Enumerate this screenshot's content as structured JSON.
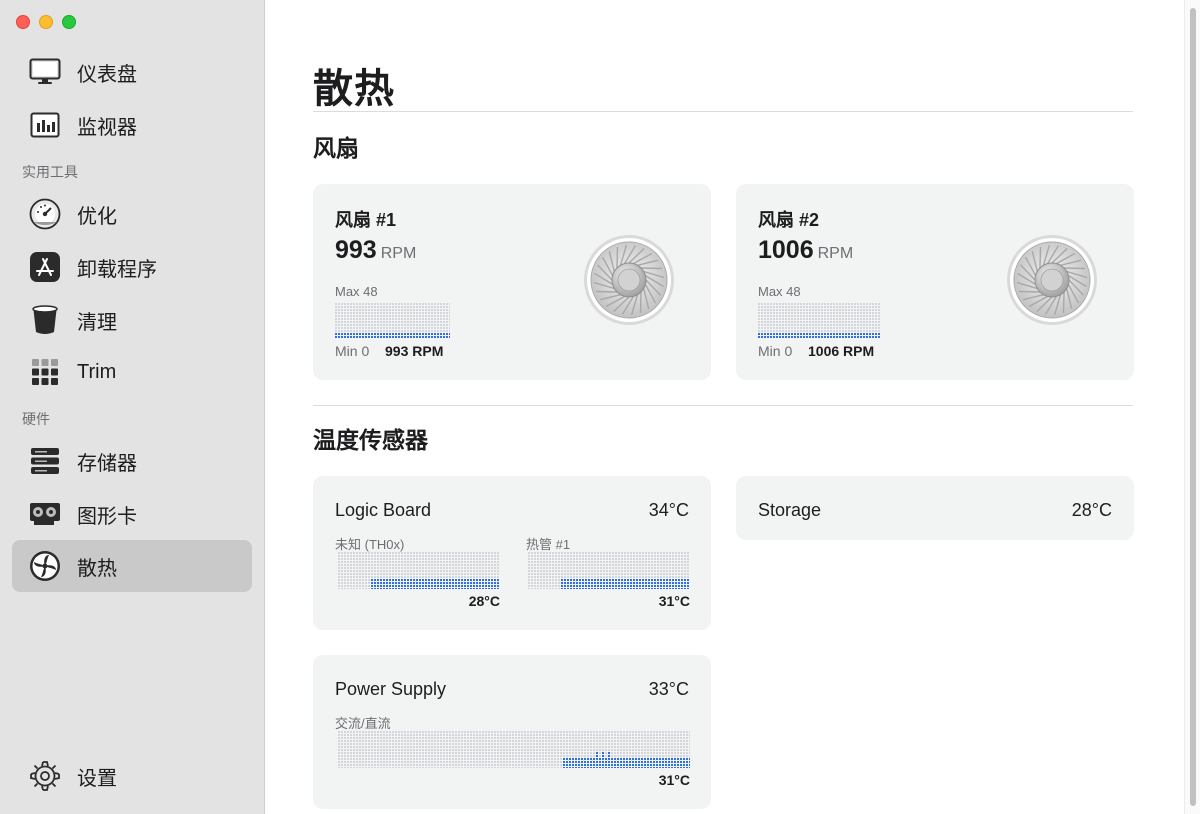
{
  "window": {
    "controls": [
      "close",
      "minimize",
      "zoom"
    ]
  },
  "sidebar": {
    "top_items": [
      {
        "label": "仪表盘",
        "icon": "monitor-icon"
      },
      {
        "label": "监视器",
        "icon": "bar-chart-icon"
      }
    ],
    "section_utilities": "实用工具",
    "utility_items": [
      {
        "label": "优化",
        "icon": "gauge-icon"
      },
      {
        "label": "卸载程序",
        "icon": "app-store-icon"
      },
      {
        "label": "清理",
        "icon": "trash-can-icon"
      },
      {
        "label": "Trim",
        "icon": "grid-icon"
      }
    ],
    "section_hardware": "硬件",
    "hardware_items": [
      {
        "label": "存储器",
        "icon": "server-stack-icon"
      },
      {
        "label": "图形卡",
        "icon": "graphics-card-icon"
      },
      {
        "label": "散热",
        "icon": "fan-icon",
        "active": true
      }
    ],
    "settings": {
      "label": "设置",
      "icon": "gear-icon"
    }
  },
  "main": {
    "title": "散热",
    "fans_section": "风扇",
    "fans": [
      {
        "name": "风扇 #1",
        "rpm": "993",
        "unit": "RPM",
        "max_label": "Max 48",
        "min_label": "Min 0",
        "current": "993 RPM"
      },
      {
        "name": "风扇 #2",
        "rpm": "1006",
        "unit": "RPM",
        "max_label": "Max 48",
        "min_label": "Min 0",
        "current": "1006 RPM"
      }
    ],
    "temps_section": "温度传感器",
    "temps": {
      "logic_board": {
        "name": "Logic Board",
        "value": "34°C",
        "sensors": [
          {
            "label": "未知 (TH0x)",
            "value": "28°C"
          },
          {
            "label": "热管 #1",
            "value": "31°C"
          }
        ]
      },
      "storage": {
        "name": "Storage",
        "value": "28°C"
      },
      "power_supply": {
        "name": "Power Supply",
        "value": "33°C",
        "sensors": [
          {
            "label": "交流/直流",
            "value": "31°C"
          }
        ]
      }
    }
  },
  "colors": {
    "accent_blue": "#2f6fe0",
    "dot_gray": "#d3d6da",
    "sidebar_bg": "#e3e3e3",
    "card_bg": "#f2f3f3"
  }
}
